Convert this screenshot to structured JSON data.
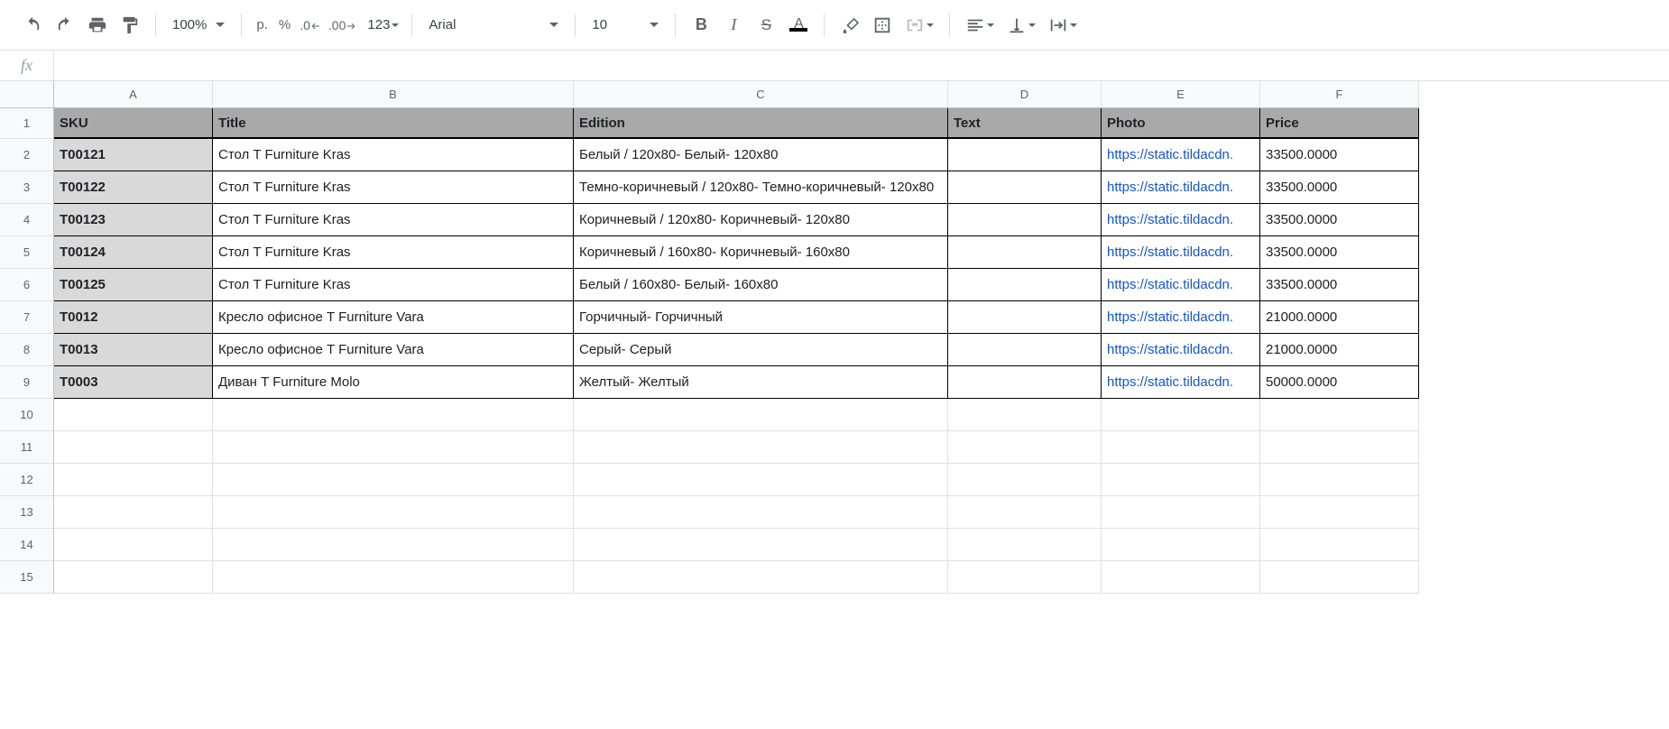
{
  "toolbar": {
    "zoom": "100%",
    "currency": "р.",
    "percent": "%",
    "dec_dec": ".0",
    "inc_dec": ".00",
    "more_formats": "123",
    "font": "Arial",
    "font_size": "10"
  },
  "formula_bar": {
    "fx": "fx",
    "value": ""
  },
  "columns": [
    "A",
    "B",
    "C",
    "D",
    "E",
    "F"
  ],
  "headers": {
    "A": "SKU",
    "B": "Title",
    "C": "Edition",
    "D": "Text",
    "E": "Photo",
    "F": "Price"
  },
  "rows": [
    {
      "sku": "T00121",
      "title": "Стол T Furniture Kras",
      "edition": "Белый / 120x80- Белый- 120x80",
      "text": "",
      "photo": "https://static.tildacdn.",
      "price": "33500.0000"
    },
    {
      "sku": "T00122",
      "title": "Стол T Furniture Kras",
      "edition": "Темно-коричневый / 120x80- Темно-коричневый- 120x80",
      "text": "",
      "photo": "https://static.tildacdn.",
      "price": "33500.0000",
      "overflow": true
    },
    {
      "sku": "T00123",
      "title": "Стол T Furniture Kras",
      "edition": "Коричневый / 120x80- Коричневый- 120x80",
      "text": "",
      "photo": "https://static.tildacdn.",
      "price": "33500.0000"
    },
    {
      "sku": "T00124",
      "title": "Стол T Furniture Kras",
      "edition": "Коричневый / 160x80- Коричневый- 160x80",
      "text": "",
      "photo": "https://static.tildacdn.",
      "price": "33500.0000"
    },
    {
      "sku": "T00125",
      "title": "Стол T Furniture Kras",
      "edition": "Белый / 160x80- Белый- 160x80",
      "text": "",
      "photo": "https://static.tildacdn.",
      "price": "33500.0000"
    },
    {
      "sku": "T0012",
      "title": "Кресло офисное T Furniture Vara",
      "edition": "Горчичный- Горчичный",
      "text": "",
      "photo": "https://static.tildacdn.",
      "price": "21000.0000"
    },
    {
      "sku": "T0013",
      "title": "Кресло офисное T Furniture Vara",
      "edition": "Серый- Серый",
      "text": "",
      "photo": "https://static.tildacdn.",
      "price": "21000.0000"
    },
    {
      "sku": "T0003",
      "title": "Диван T Furniture Molo",
      "edition": "Желтый- Желтый",
      "text": "",
      "photo": "https://static.tildacdn.",
      "price": "50000.0000"
    }
  ],
  "empty_rows": [
    10,
    11,
    12,
    13,
    14,
    15
  ]
}
